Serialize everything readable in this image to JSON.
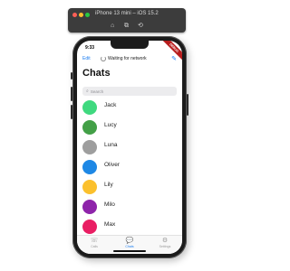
{
  "simulator": {
    "title": "iPhone 13 mini – iOS 15.2",
    "buttons": [
      "⌂",
      "⧉",
      "⟲"
    ]
  },
  "status": {
    "time": "9:33"
  },
  "debug_banner": "DEBUG",
  "nav": {
    "edit_label": "Edit",
    "title": "Waiting for network",
    "compose_icon": "compose-icon"
  },
  "page_title": "Chats",
  "search": {
    "placeholder": "Search"
  },
  "chats": [
    {
      "name": "Jack",
      "color": "#3fd97f"
    },
    {
      "name": "Lucy",
      "color": "#43a047"
    },
    {
      "name": "Luna",
      "color": "#9e9e9e"
    },
    {
      "name": "Oliver",
      "color": "#1e88e5"
    },
    {
      "name": "Lily",
      "color": "#fbc02d"
    },
    {
      "name": "Milo",
      "color": "#8e24aa"
    },
    {
      "name": "Max",
      "color": "#e91e63"
    }
  ],
  "tabs": [
    {
      "label": "Calls",
      "icon": "phone-icon",
      "glyph": "☏",
      "active": false
    },
    {
      "label": "Chats",
      "icon": "chat-icon",
      "glyph": "💬",
      "active": true
    },
    {
      "label": "Settings",
      "icon": "settings-icon",
      "glyph": "⚙",
      "active": false
    }
  ]
}
